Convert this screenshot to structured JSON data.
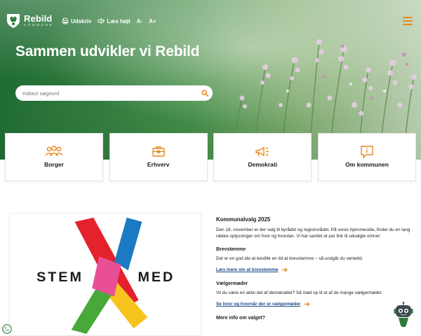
{
  "header": {
    "logo": {
      "name": "Rebild",
      "sub": "KOMMUNE"
    },
    "tools": [
      {
        "label": "Udskriv",
        "icon": "print-icon"
      },
      {
        "label": "Læs højt",
        "icon": "speaker-icon"
      },
      {
        "label": "A-",
        "icon": ""
      },
      {
        "label": "A+",
        "icon": ""
      }
    ],
    "menu_icon": "hamburger-icon"
  },
  "hero": {
    "title": "Sammen udvikler vi Rebild",
    "search_placeholder": "Indtast søgeord"
  },
  "cards": [
    {
      "label": "Borger",
      "icon": "people-icon"
    },
    {
      "label": "Erhverv",
      "icon": "briefcase-icon"
    },
    {
      "label": "Demokrati",
      "icon": "megaphone-icon"
    },
    {
      "label": "Om kommunen",
      "icon": "info-bubble-icon"
    }
  ],
  "campaign_image": {
    "left_word": "STEM",
    "right_word": "MED"
  },
  "article": {
    "title": "Kommunalvalg 2025",
    "intro": "Den 18. november er der valg til byrådet og regionsrådet. På vores hjemmeside, finder du en lang række oplysninger om hvor og hvordan. Vi har samlet et par link til udvalgte emner:",
    "sections": [
      {
        "heading": "Brevstemme",
        "text": "Det er en god ide at bestille en tid at brevstemme – så undgår du ventetid.",
        "link": "Læs mere om at brevstemme"
      },
      {
        "heading": "Vælgermøder",
        "text": "Vil du være en aktiv del af demokratiet? Så mød op til et af de mange vælgermøder.",
        "link": "Se hvor og hvornår der er vælgermøder"
      }
    ],
    "next_heading": "Mere info om valget?"
  },
  "colors": {
    "accent": "#e8891d",
    "link": "#1a4a8a",
    "hero_green": "#2d7a3c"
  }
}
